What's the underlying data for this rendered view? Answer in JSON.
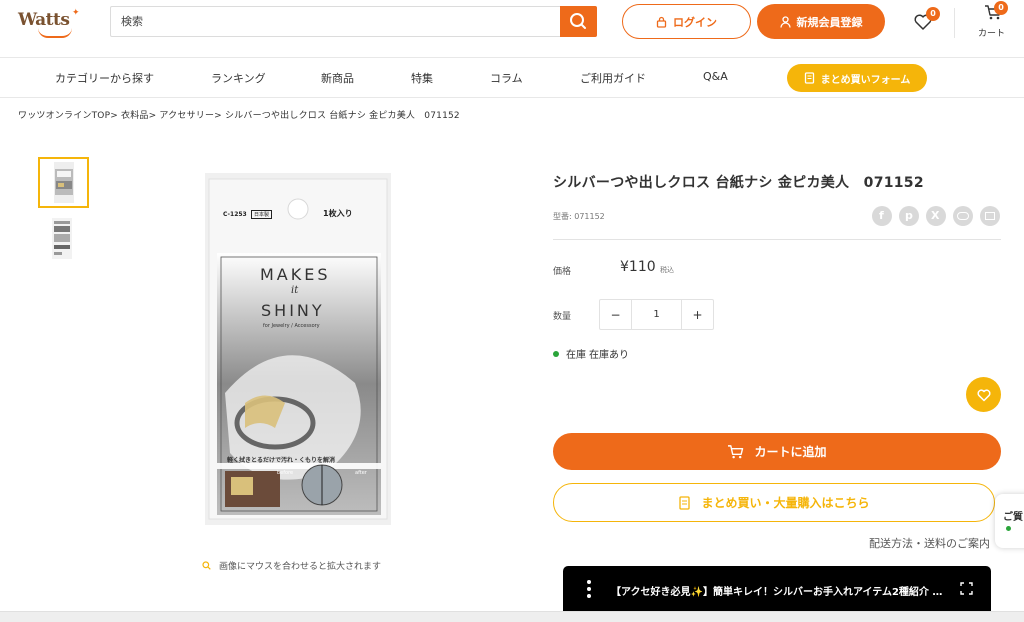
{
  "header": {
    "logo_text": "Watts",
    "search_placeholder": "検索",
    "login_label": "ログイン",
    "register_label": "新規会員登録",
    "favorites_count": "0",
    "cart_count": "0",
    "cart_label": "カート"
  },
  "nav": {
    "items": [
      "カテゴリーから探す",
      "ランキング",
      "新商品",
      "特集",
      "コラム",
      "ご利用ガイド",
      "Q&A"
    ],
    "bulk_form_label": "まとめ買いフォーム"
  },
  "breadcrumb": "ワッツオンラインTOP> 衣料品> アクセサリー> シルバーつや出しクロス 台紙ナシ 金ピカ美人　071152",
  "gallery": {
    "zoom_hint": "画像にマウスを合わせると拡大されます",
    "package": {
      "code": "C-1253",
      "made_in": "日本製",
      "count": "1枚入り",
      "brand_line1": "MAKES",
      "brand_it": "it",
      "brand_line2": "SHINY",
      "sub": "for Jewelry / Accessory",
      "bottom": "軽く拭きとるだけで汚れ・くもりを解消",
      "before": "before",
      "after": "after"
    }
  },
  "product": {
    "title": "シルバーつや出しクロス 台紙ナシ 金ピカ美人　071152",
    "model_label": "型番: 071152",
    "price_label": "価格",
    "price": "¥110",
    "tax_label": "税込",
    "qty_label": "数量",
    "qty_value": "1",
    "stock_label": "在庫",
    "stock_status": "在庫あり",
    "add_to_cart": "カートに追加",
    "bulk_buy": "まとめ買い・大量購入はこちら",
    "shipping_link": "配送方法・送料のご案内"
  },
  "side_peek": {
    "text": "ご質"
  },
  "video_bar": {
    "text": "【アクセ好き必見✨】簡単キレイ！シルバーお手入れアイテム2種紹介 大..."
  },
  "colors": {
    "accent": "#ee6a1a",
    "secondary": "#f5b50a",
    "in_stock": "#2aa53a"
  }
}
